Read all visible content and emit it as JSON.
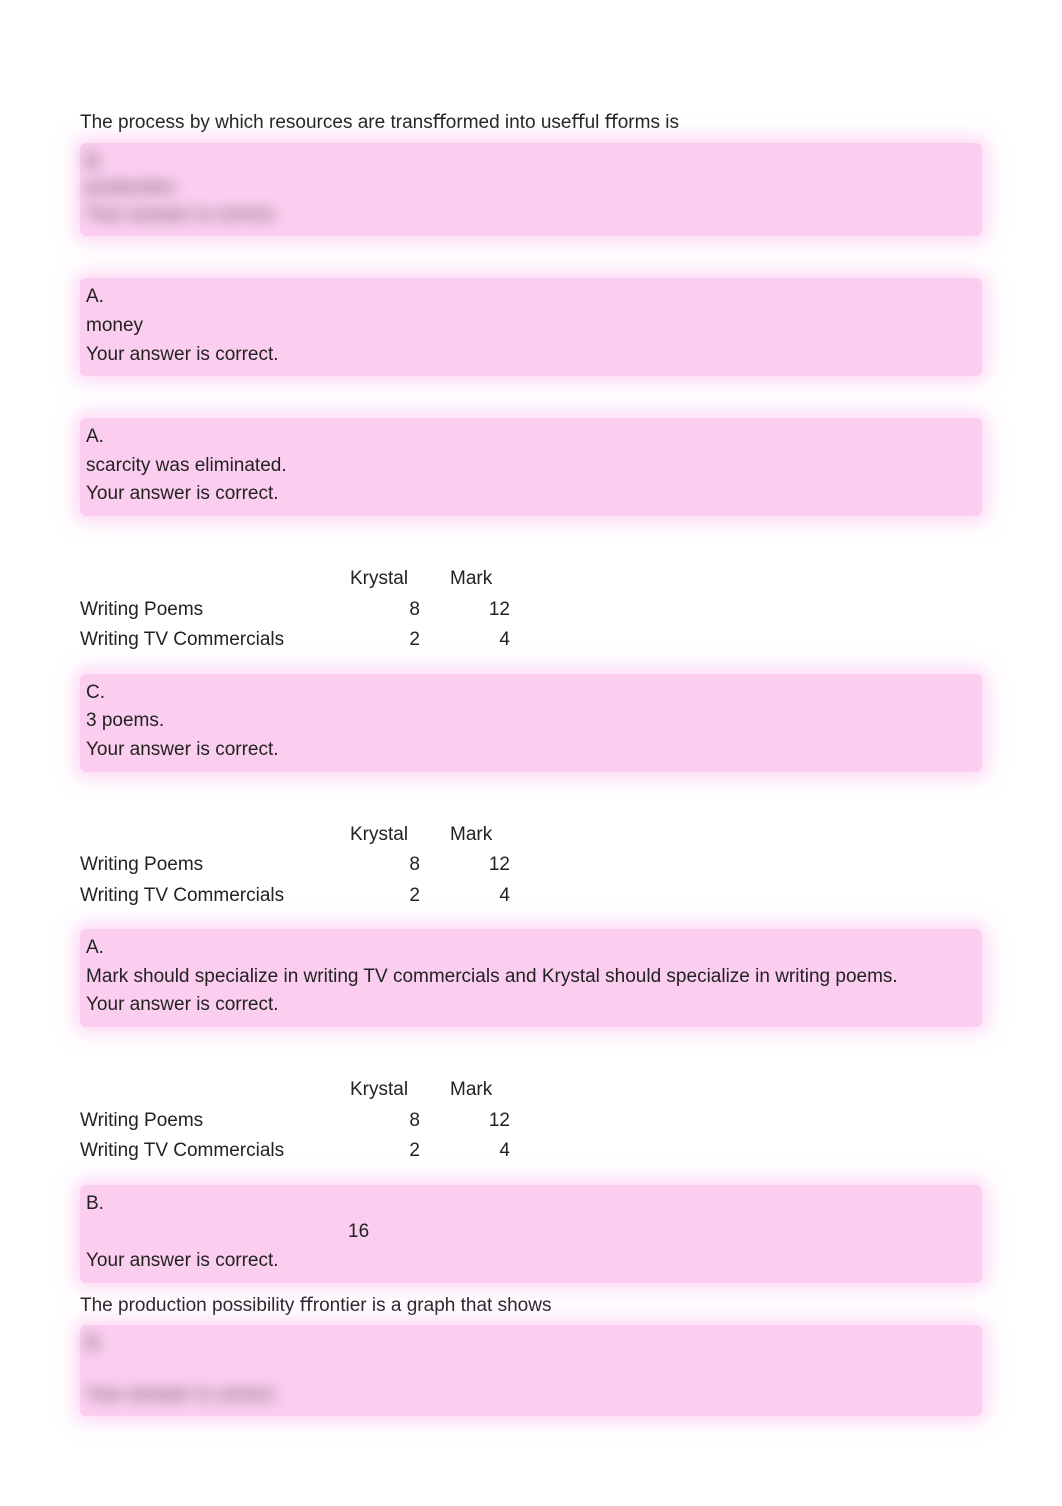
{
  "q1": {
    "question": "The process by which resources are transﬀormed into useﬀul ﬀorms is",
    "letter_blur": "B.",
    "text_blur": "production.",
    "feedback_blur": "Your answer is correct."
  },
  "q2": {
    "letter": "A.",
    "text": "money",
    "feedback": "Your answer is correct."
  },
  "q3": {
    "letter": "A.",
    "text": "scarcity was eliminated.",
    "feedback": "Your answer is correct."
  },
  "table": {
    "h1": "Krystal",
    "h2": "Mark",
    "r1_label": "Writing Poems",
    "r1_v1": "8",
    "r1_v2": "12",
    "r2_label": "Writing TV Commercials",
    "r2_v1": "2",
    "r2_v2": "4"
  },
  "q4": {
    "letter": "C.",
    "text": "3 poems.",
    "feedback": "Your answer is correct."
  },
  "q5": {
    "letter": "A.",
    "text": "Mark should specialize in writing TV commercials and Krystal should specialize in writing poems.",
    "feedback": "Your answer is correct."
  },
  "q6": {
    "letter": "B.",
    "value": "16",
    "feedback": "Your answer is correct."
  },
  "q7": {
    "question": "The production possibility ﬀrontier is a graph that shows",
    "letter_blur": "B.",
    "feedback_blur": "Your answer is correct."
  }
}
